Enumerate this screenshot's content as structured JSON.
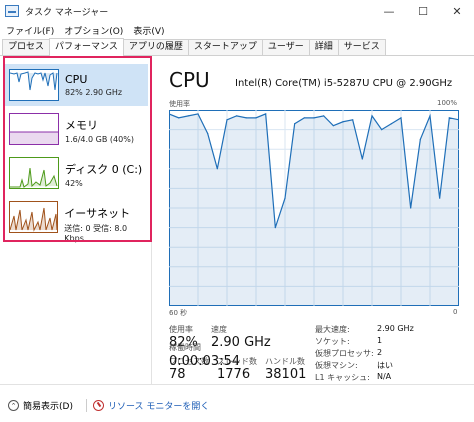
{
  "window": {
    "title": "タスク マネージャー",
    "controls": [
      "—",
      "☐",
      "✕"
    ]
  },
  "menu": [
    {
      "label": "ファイル(F)"
    },
    {
      "label": "オプション(O)"
    },
    {
      "label": "表示(V)"
    }
  ],
  "tabs": [
    {
      "label": "プロセス",
      "active": false
    },
    {
      "label": "パフォーマンス",
      "active": true
    },
    {
      "label": "アプリの履歴",
      "active": false
    },
    {
      "label": "スタートアップ",
      "active": false
    },
    {
      "label": "ユーザー",
      "active": false
    },
    {
      "label": "詳細",
      "active": false
    },
    {
      "label": "サービス",
      "active": false
    }
  ],
  "sidebar": {
    "items": [
      {
        "title": "CPU",
        "sub": "82% 2.90 GHz",
        "selected": true,
        "color": "#1f6fb8"
      },
      {
        "title": "メモリ",
        "sub": "1.6/4.0 GB (40%)",
        "selected": false,
        "color": "#8b2fa8"
      },
      {
        "title": "ディスク 0 (C:)",
        "sub": "42%",
        "selected": false,
        "color": "#4d9a1a"
      },
      {
        "title": "イーサネット",
        "sub": "送信: 0 受信: 8.0 Kbps",
        "selected": false,
        "color": "#a0521b"
      }
    ]
  },
  "main": {
    "title": "CPU",
    "model": "Intel(R) Core(TM) i5-5287U CPU @ 2.90GHz",
    "graph_top_left": "使用率",
    "graph_top_right": "100%",
    "graph_bottom_left": "60 秒",
    "graph_bottom_right": "0",
    "graph_color": "#1f6fb8"
  },
  "chart_data": {
    "type": "line",
    "ylim": [
      0,
      100
    ],
    "x": [
      60,
      58,
      56,
      54,
      52,
      50,
      48,
      46,
      44,
      42,
      40,
      38,
      36,
      34,
      32,
      30,
      28,
      26,
      24,
      22,
      20,
      18,
      16,
      14,
      12,
      10,
      8,
      6,
      4,
      2,
      0
    ],
    "values": [
      98,
      96,
      97,
      98,
      88,
      70,
      95,
      97,
      96,
      96,
      98,
      40,
      55,
      93,
      96,
      96,
      97,
      92,
      94,
      95,
      75,
      97,
      90,
      93,
      96,
      50,
      85,
      97,
      55,
      96,
      95
    ]
  },
  "stats": {
    "usage_label": "使用率",
    "usage_value": "82%",
    "speed_label": "速度",
    "speed_value": "2.90 GHz",
    "processes_label": "プロセス数",
    "processes_value": "78",
    "threads_label": "スレッド数",
    "threads_value": "1776",
    "handles_label": "ハンドル数",
    "handles_value": "38101",
    "uptime_label": "稼働時間",
    "uptime_value": "0:00:03:54"
  },
  "specs": [
    {
      "label": "最大速度:",
      "value": "2.90 GHz"
    },
    {
      "label": "ソケット:",
      "value": "1"
    },
    {
      "label": "仮想プロセッサ:",
      "value": "2"
    },
    {
      "label": "仮想マシン:",
      "value": "はい"
    },
    {
      "label": "L1 キャッシュ:",
      "value": "N/A"
    }
  ],
  "footer": {
    "brief_label": "簡易表示(D)",
    "resmon_label": "リソース モニターを開く"
  }
}
